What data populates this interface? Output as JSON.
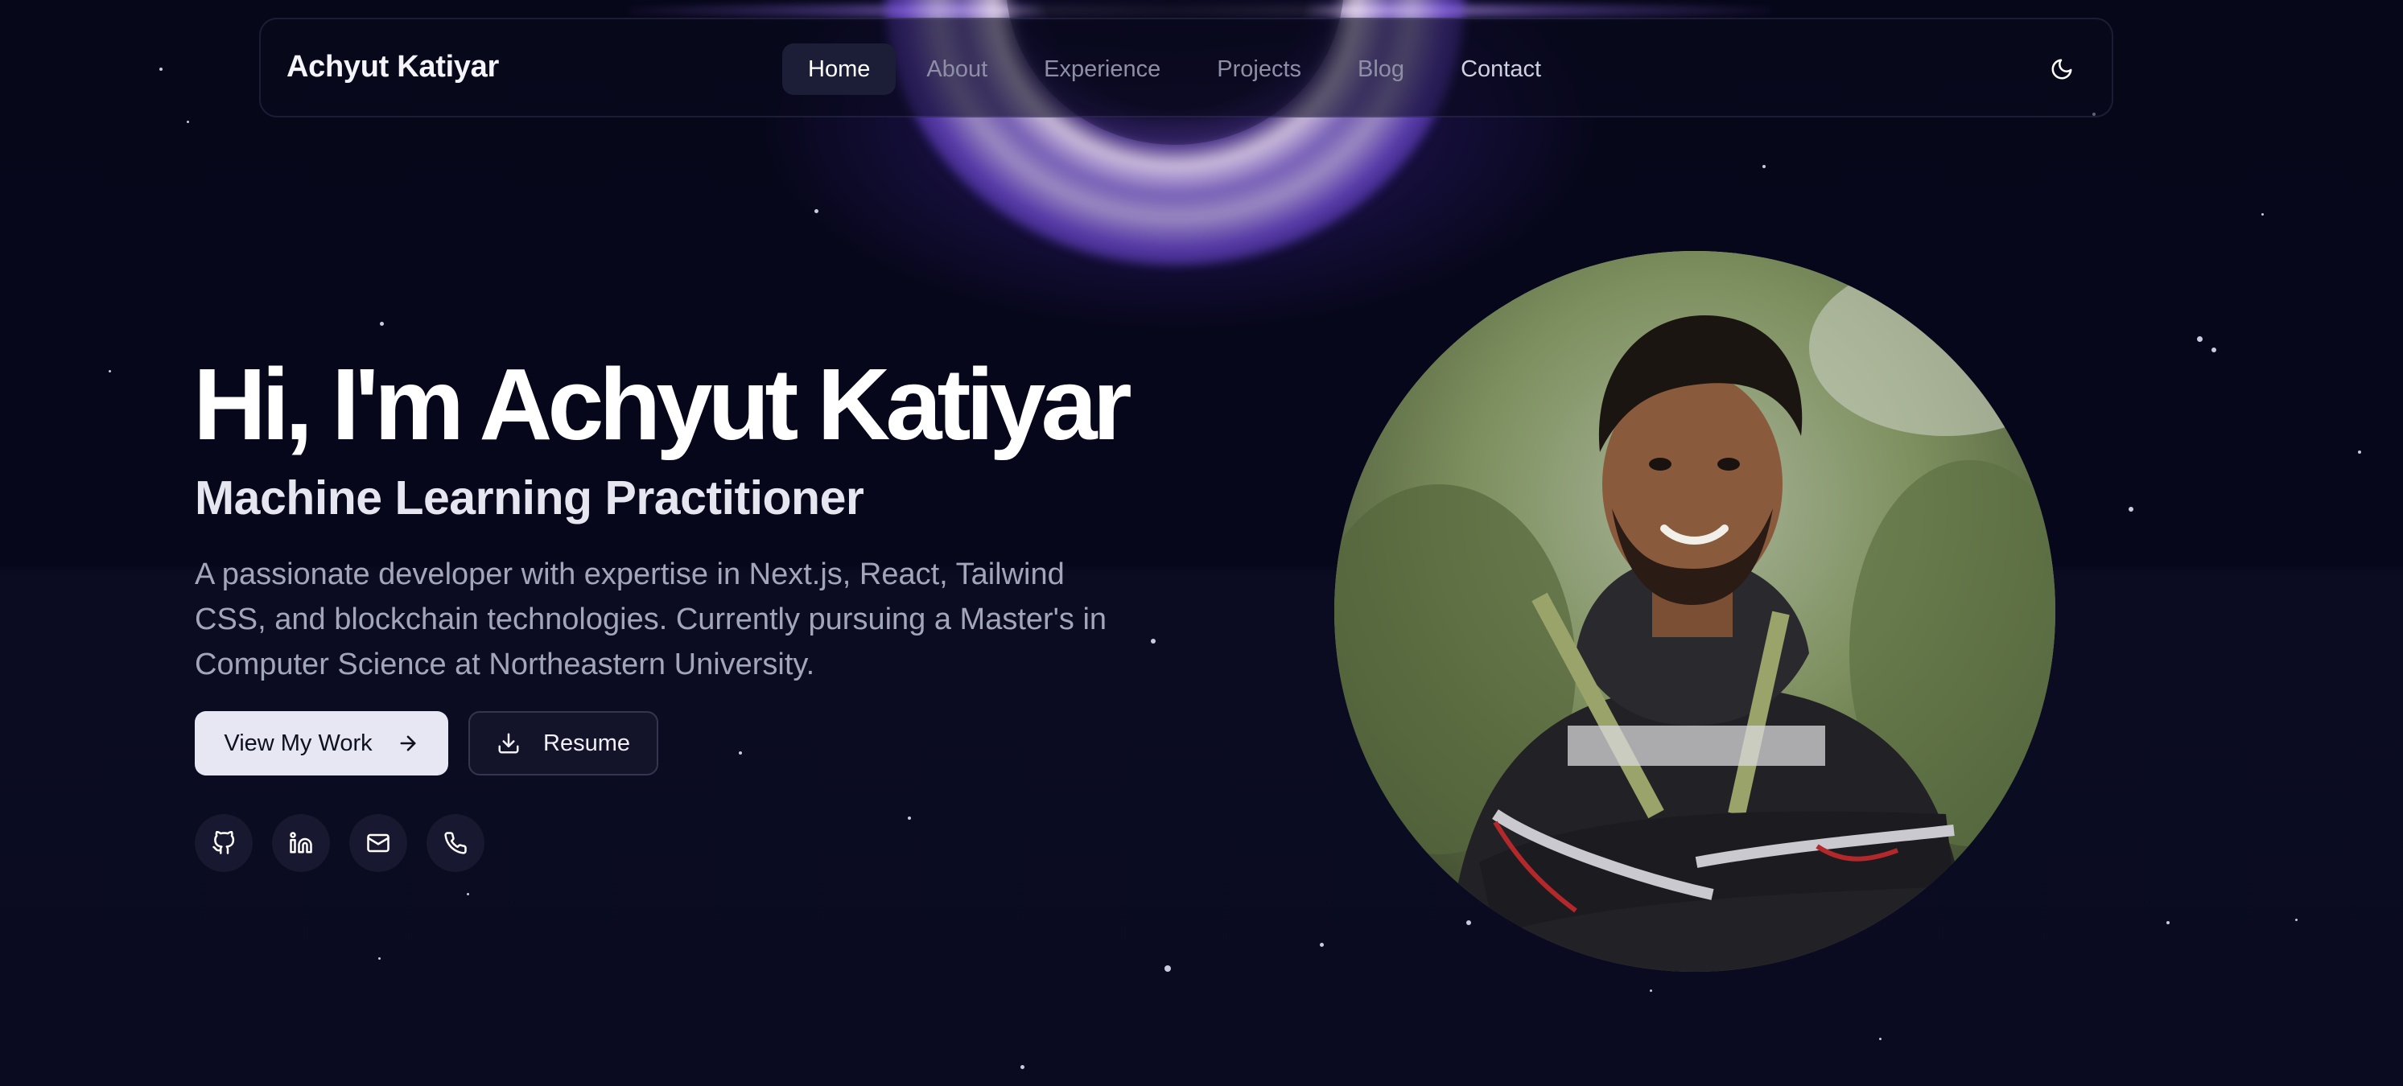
{
  "nav": {
    "brand": "Achyut Katiyar",
    "links": [
      "Home",
      "About",
      "Experience",
      "Projects",
      "Blog",
      "Contact"
    ],
    "active": "Home",
    "theme_toggle_icon": "moon-icon"
  },
  "hero": {
    "title": "Hi, I'm Achyut Katiyar",
    "subtitle": "Machine Learning Practitioner",
    "description": "A passionate developer with expertise in Next.js, React, Tailwind CSS, and blockchain technologies. Currently pursuing a Master's in Computer Science at Northeastern University.",
    "primary_button": "View My Work",
    "primary_button_icon": "arrow-right-icon",
    "secondary_button": "Resume",
    "secondary_button_icon": "download-icon",
    "socials": [
      "github-icon",
      "linkedin-icon",
      "mail-icon",
      "phone-icon"
    ]
  },
  "colors": {
    "background": "#07071a",
    "accent_glow": "#8c5aff",
    "primary_button_bg": "#e6e7f2"
  }
}
